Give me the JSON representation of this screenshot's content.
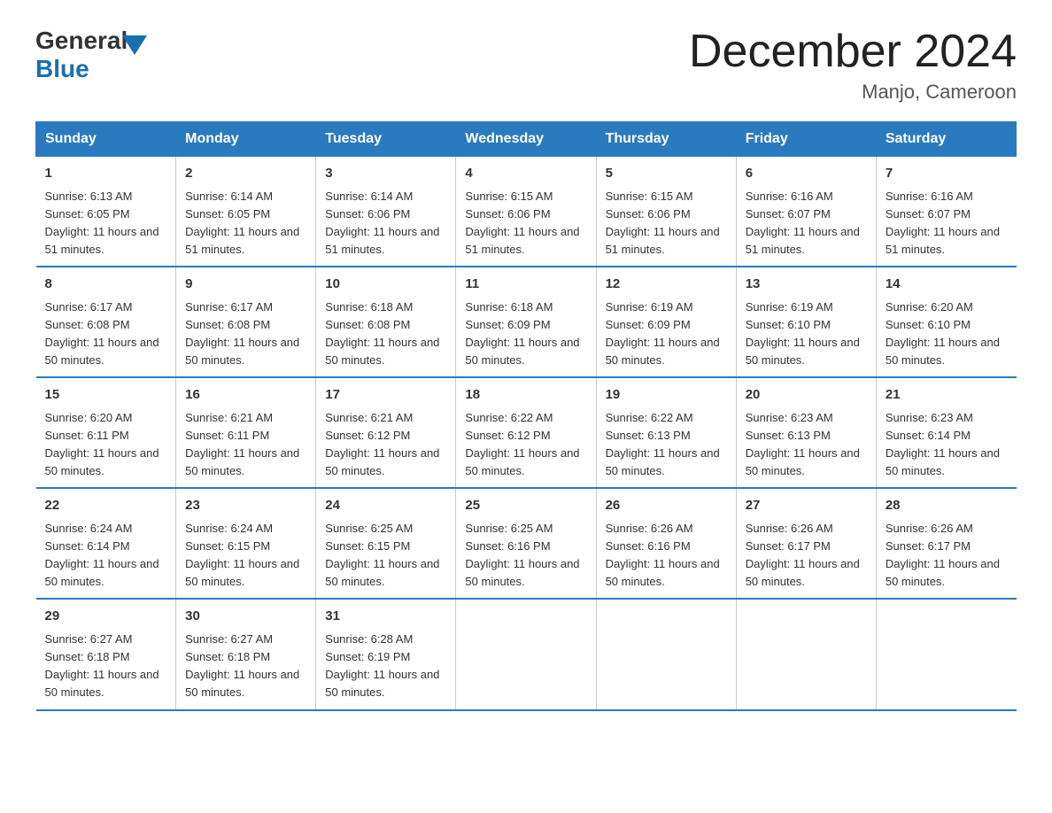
{
  "logo": {
    "general": "General",
    "blue": "Blue"
  },
  "title": "December 2024",
  "location": "Manjo, Cameroon",
  "days_of_week": [
    "Sunday",
    "Monday",
    "Tuesday",
    "Wednesday",
    "Thursday",
    "Friday",
    "Saturday"
  ],
  "weeks": [
    [
      {
        "day": "1",
        "sunrise": "6:13 AM",
        "sunset": "6:05 PM",
        "daylight": "11 hours and 51 minutes."
      },
      {
        "day": "2",
        "sunrise": "6:14 AM",
        "sunset": "6:05 PM",
        "daylight": "11 hours and 51 minutes."
      },
      {
        "day": "3",
        "sunrise": "6:14 AM",
        "sunset": "6:06 PM",
        "daylight": "11 hours and 51 minutes."
      },
      {
        "day": "4",
        "sunrise": "6:15 AM",
        "sunset": "6:06 PM",
        "daylight": "11 hours and 51 minutes."
      },
      {
        "day": "5",
        "sunrise": "6:15 AM",
        "sunset": "6:06 PM",
        "daylight": "11 hours and 51 minutes."
      },
      {
        "day": "6",
        "sunrise": "6:16 AM",
        "sunset": "6:07 PM",
        "daylight": "11 hours and 51 minutes."
      },
      {
        "day": "7",
        "sunrise": "6:16 AM",
        "sunset": "6:07 PM",
        "daylight": "11 hours and 51 minutes."
      }
    ],
    [
      {
        "day": "8",
        "sunrise": "6:17 AM",
        "sunset": "6:08 PM",
        "daylight": "11 hours and 50 minutes."
      },
      {
        "day": "9",
        "sunrise": "6:17 AM",
        "sunset": "6:08 PM",
        "daylight": "11 hours and 50 minutes."
      },
      {
        "day": "10",
        "sunrise": "6:18 AM",
        "sunset": "6:08 PM",
        "daylight": "11 hours and 50 minutes."
      },
      {
        "day": "11",
        "sunrise": "6:18 AM",
        "sunset": "6:09 PM",
        "daylight": "11 hours and 50 minutes."
      },
      {
        "day": "12",
        "sunrise": "6:19 AM",
        "sunset": "6:09 PM",
        "daylight": "11 hours and 50 minutes."
      },
      {
        "day": "13",
        "sunrise": "6:19 AM",
        "sunset": "6:10 PM",
        "daylight": "11 hours and 50 minutes."
      },
      {
        "day": "14",
        "sunrise": "6:20 AM",
        "sunset": "6:10 PM",
        "daylight": "11 hours and 50 minutes."
      }
    ],
    [
      {
        "day": "15",
        "sunrise": "6:20 AM",
        "sunset": "6:11 PM",
        "daylight": "11 hours and 50 minutes."
      },
      {
        "day": "16",
        "sunrise": "6:21 AM",
        "sunset": "6:11 PM",
        "daylight": "11 hours and 50 minutes."
      },
      {
        "day": "17",
        "sunrise": "6:21 AM",
        "sunset": "6:12 PM",
        "daylight": "11 hours and 50 minutes."
      },
      {
        "day": "18",
        "sunrise": "6:22 AM",
        "sunset": "6:12 PM",
        "daylight": "11 hours and 50 minutes."
      },
      {
        "day": "19",
        "sunrise": "6:22 AM",
        "sunset": "6:13 PM",
        "daylight": "11 hours and 50 minutes."
      },
      {
        "day": "20",
        "sunrise": "6:23 AM",
        "sunset": "6:13 PM",
        "daylight": "11 hours and 50 minutes."
      },
      {
        "day": "21",
        "sunrise": "6:23 AM",
        "sunset": "6:14 PM",
        "daylight": "11 hours and 50 minutes."
      }
    ],
    [
      {
        "day": "22",
        "sunrise": "6:24 AM",
        "sunset": "6:14 PM",
        "daylight": "11 hours and 50 minutes."
      },
      {
        "day": "23",
        "sunrise": "6:24 AM",
        "sunset": "6:15 PM",
        "daylight": "11 hours and 50 minutes."
      },
      {
        "day": "24",
        "sunrise": "6:25 AM",
        "sunset": "6:15 PM",
        "daylight": "11 hours and 50 minutes."
      },
      {
        "day": "25",
        "sunrise": "6:25 AM",
        "sunset": "6:16 PM",
        "daylight": "11 hours and 50 minutes."
      },
      {
        "day": "26",
        "sunrise": "6:26 AM",
        "sunset": "6:16 PM",
        "daylight": "11 hours and 50 minutes."
      },
      {
        "day": "27",
        "sunrise": "6:26 AM",
        "sunset": "6:17 PM",
        "daylight": "11 hours and 50 minutes."
      },
      {
        "day": "28",
        "sunrise": "6:26 AM",
        "sunset": "6:17 PM",
        "daylight": "11 hours and 50 minutes."
      }
    ],
    [
      {
        "day": "29",
        "sunrise": "6:27 AM",
        "sunset": "6:18 PM",
        "daylight": "11 hours and 50 minutes."
      },
      {
        "day": "30",
        "sunrise": "6:27 AM",
        "sunset": "6:18 PM",
        "daylight": "11 hours and 50 minutes."
      },
      {
        "day": "31",
        "sunrise": "6:28 AM",
        "sunset": "6:19 PM",
        "daylight": "11 hours and 50 minutes."
      },
      null,
      null,
      null,
      null
    ]
  ]
}
